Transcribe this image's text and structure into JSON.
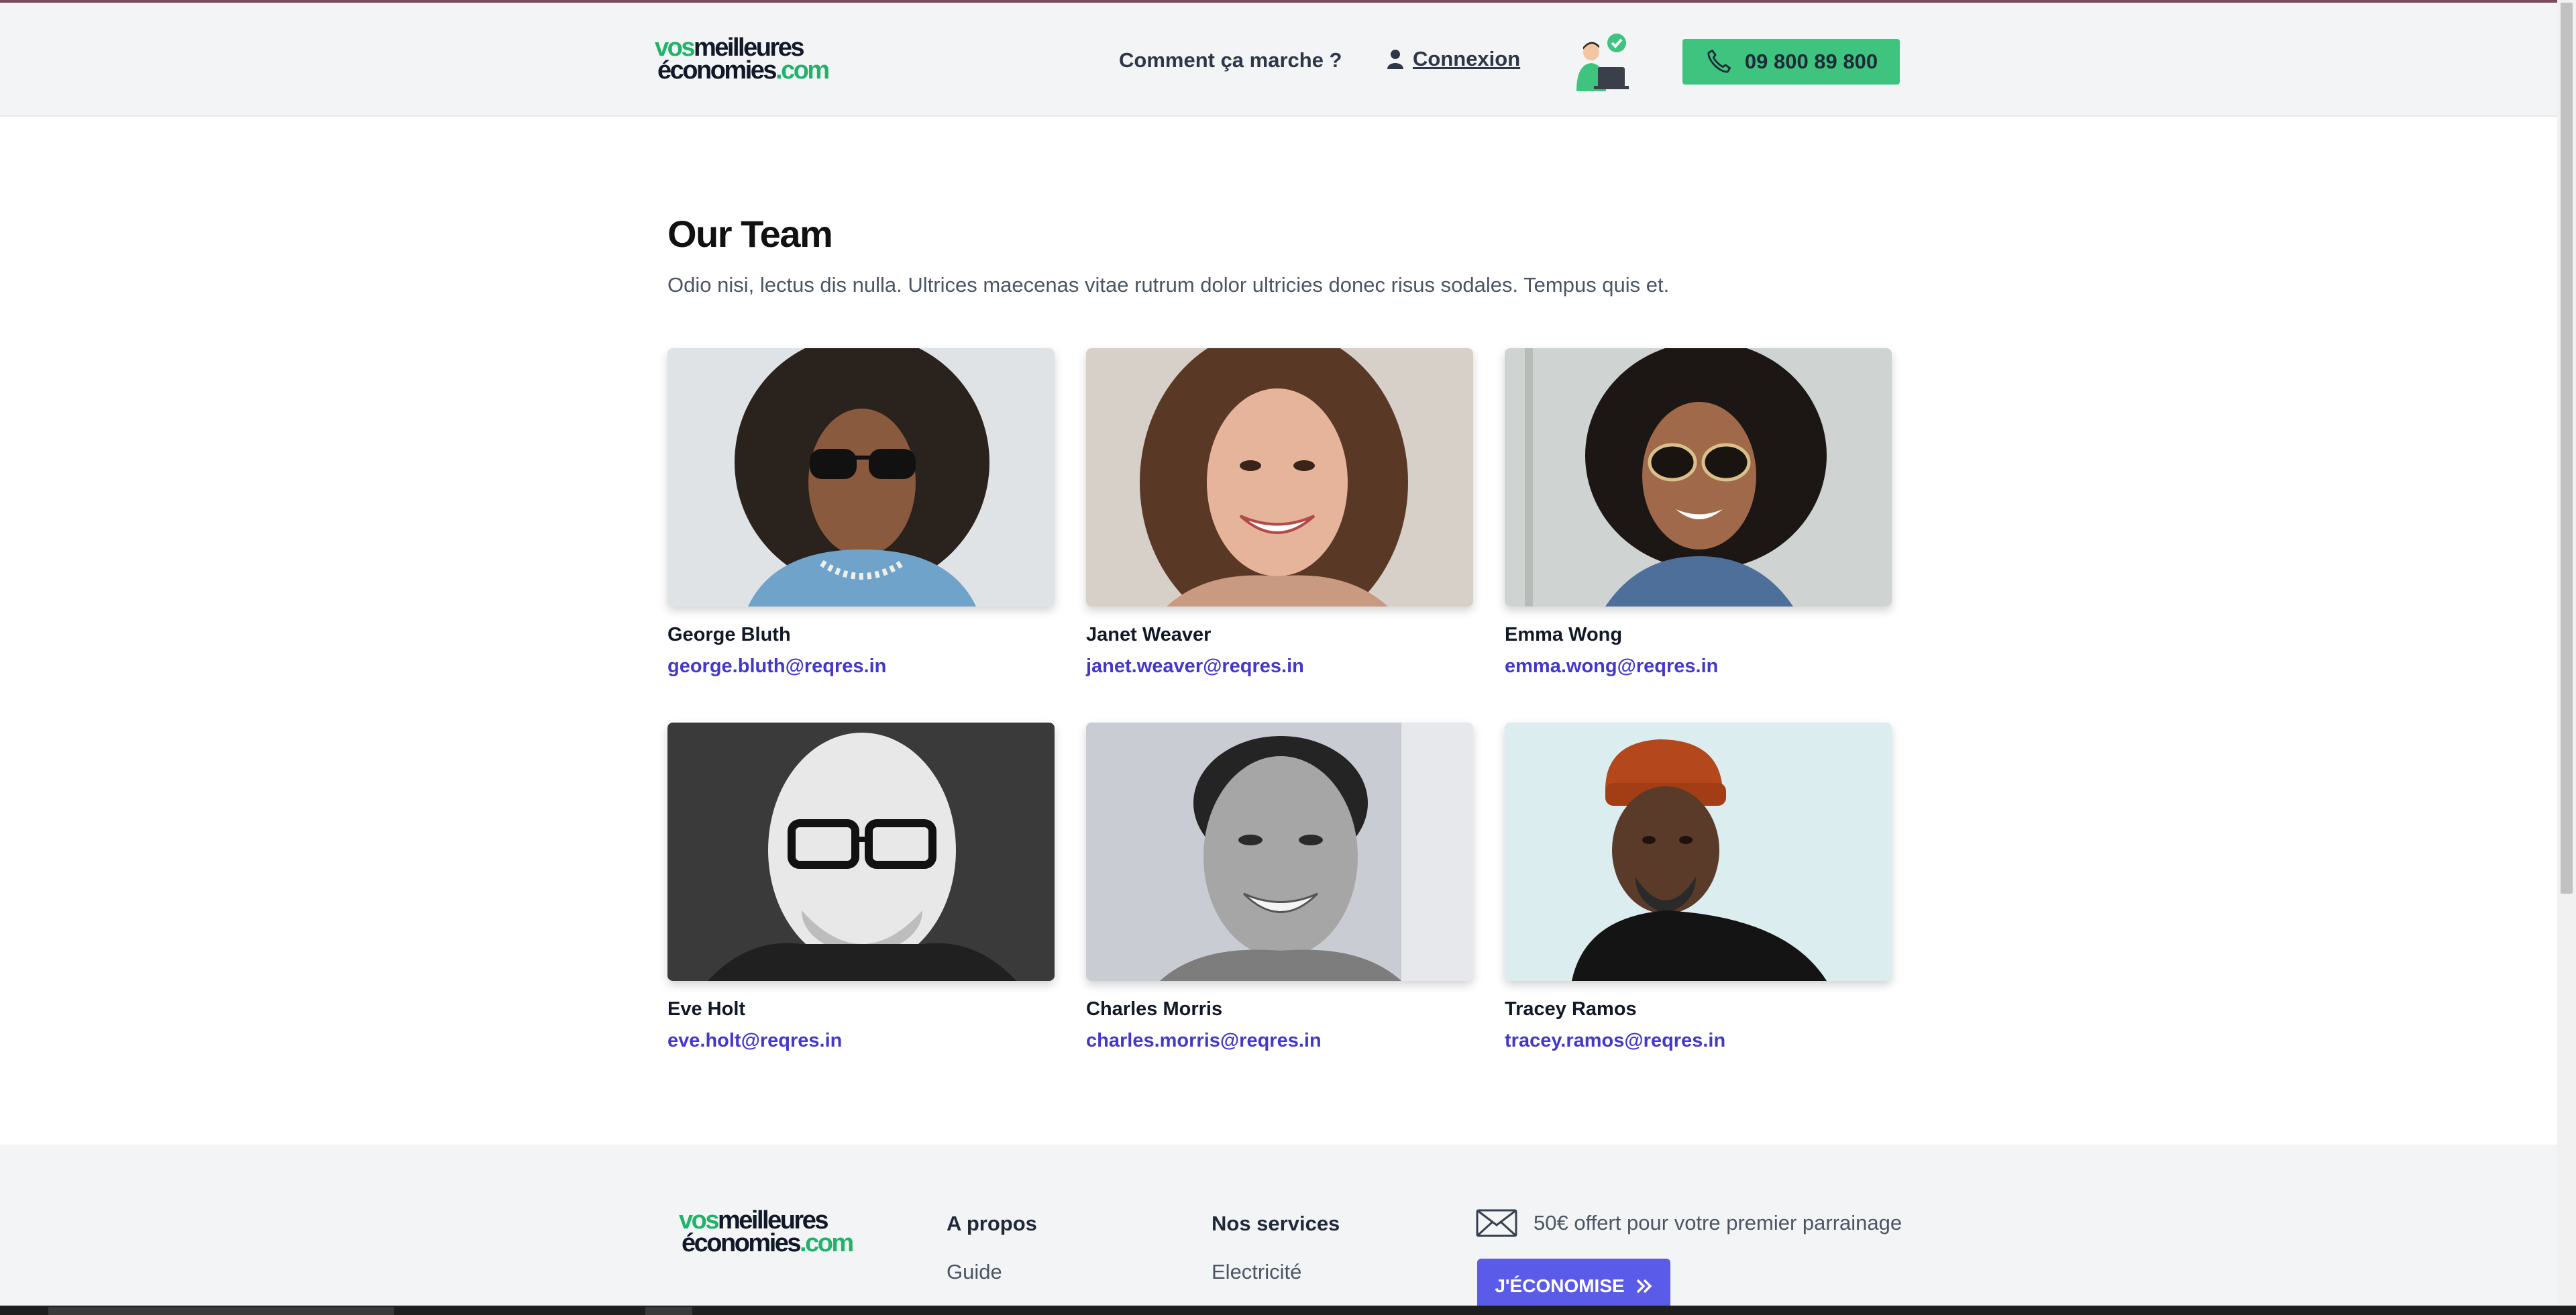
{
  "header": {
    "logo_part1": "vos",
    "logo_part2": "meilleures",
    "logo_part3": "économies",
    "logo_part4": ".com",
    "how_it_works": "Comment ça marche ?",
    "login": "Connexion",
    "phone": "09 800 89 800"
  },
  "main": {
    "title": "Our Team",
    "subtitle": "Odio nisi, lectus dis nulla. Ultrices maecenas vitae rutrum dolor ultricies donec risus sodales. Tempus quis et.",
    "team": [
      {
        "name": "George Bluth",
        "email": "george.bluth@reqres.in"
      },
      {
        "name": "Janet Weaver",
        "email": "janet.weaver@reqres.in"
      },
      {
        "name": "Emma Wong",
        "email": "emma.wong@reqres.in"
      },
      {
        "name": "Eve Holt",
        "email": "eve.holt@reqres.in"
      },
      {
        "name": "Charles Morris",
        "email": "charles.morris@reqres.in"
      },
      {
        "name": "Tracey Ramos",
        "email": "tracey.ramos@reqres.in"
      }
    ]
  },
  "footer": {
    "logo_part1": "vos",
    "logo_part2": "meilleures",
    "logo_part3": "économies",
    "logo_part4": ".com",
    "about_title": "A propos",
    "about_link": "Guide",
    "services_title": "Nos services",
    "services_link": "Electricité",
    "promo": "50€ offert pour votre premier parrainage",
    "cta": "J'ÉCONOMISE"
  },
  "colors": {
    "brand_green": "#22b36a",
    "phone_button": "#3ec47f",
    "email_link": "#4338ca",
    "cta_button": "#5b5bea"
  },
  "icons": [
    "user-icon",
    "phone-icon",
    "advisor-illustration",
    "envelope-icon",
    "double-chevron-right-icon"
  ]
}
